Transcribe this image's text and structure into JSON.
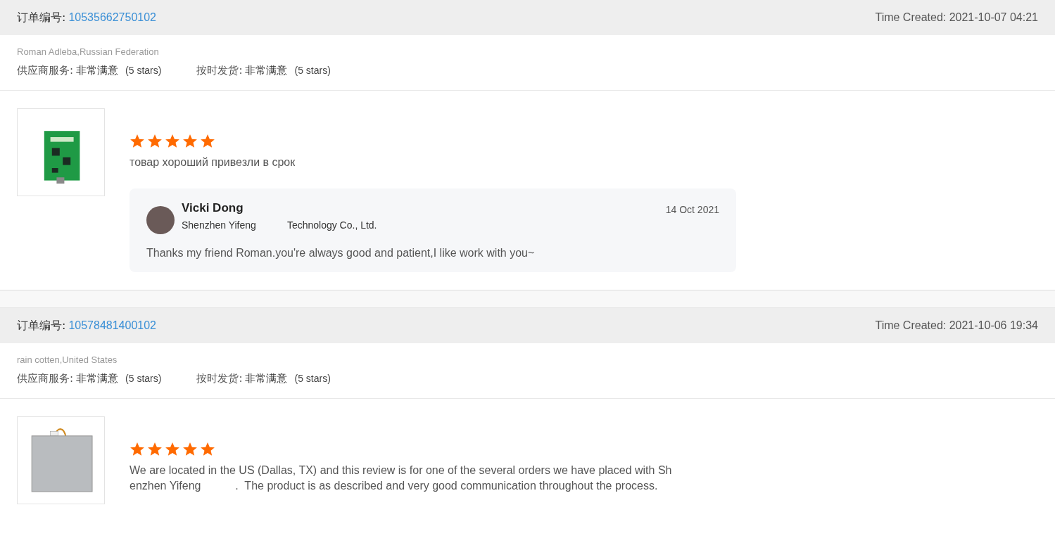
{
  "orders": [
    {
      "order_label": "订单编号:",
      "order_number": "10535662750102",
      "time_created": "Time Created: 2021-10-07 04:21",
      "buyer": "Roman Adleba,Russian Federation",
      "ratings": [
        {
          "label": "供应商服务:",
          "value": "非常满意",
          "note": "(5 stars)"
        },
        {
          "label": "按时发货:",
          "value": "非常满意",
          "note": "(5 stars)"
        }
      ],
      "product_image": {
        "kind": "board"
      },
      "stars": 5,
      "review_lines": [
        "товар хороший привезли в срок"
      ],
      "reply": {
        "name": "Vicki Dong",
        "company": "Shenzhen Yifeng",
        "company_rest": "Technology Co., Ltd.",
        "date": "14 Oct 2021",
        "text": "Thanks my friend Roman.you're always good and patient,I like work with you~"
      }
    },
    {
      "order_label": "订单编号:",
      "order_number": "10578481400102",
      "time_created": "Time Created: 2021-10-06 19:34",
      "buyer": "rain cotten,United States",
      "ratings": [
        {
          "label": "供应商服务:",
          "value": "非常满意",
          "note": "(5 stars)"
        },
        {
          "label": "按时发货:",
          "value": "非常满意",
          "note": "(5 stars)"
        }
      ],
      "product_image": {
        "kind": "plate"
      },
      "stars": 5,
      "review_lines": [
        "We are located in the US (Dallas, TX) and this review is for one of the several orders we have placed with Sh",
        "enzhen Yifeng           .  The product is as described and very good communication throughout the process."
      ]
    }
  ]
}
